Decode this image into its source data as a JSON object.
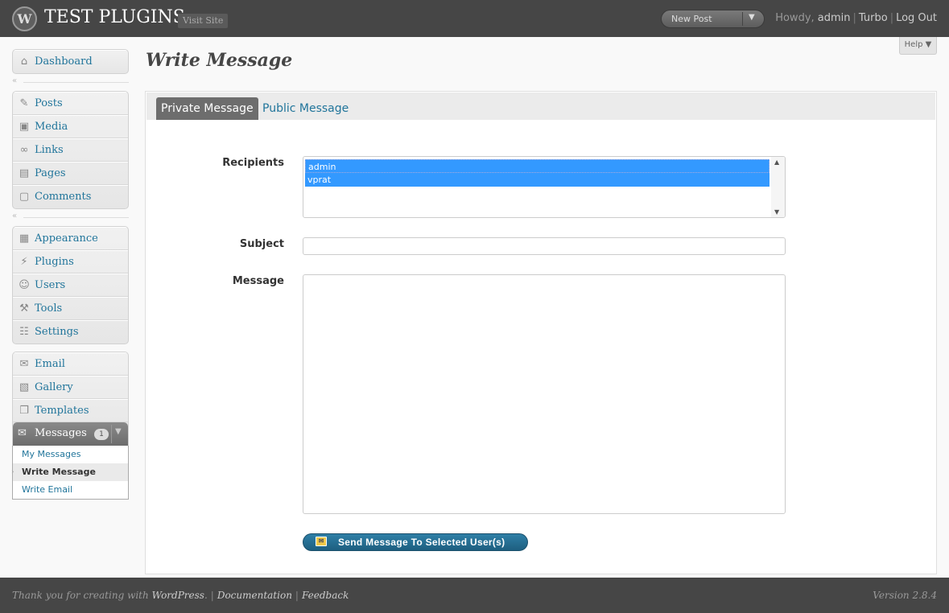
{
  "header": {
    "logo_glyph": "W",
    "site_title": "TEST PLUGINS",
    "visit_site": "Visit Site",
    "new_post": "New Post",
    "howdy_prefix": "Howdy,",
    "user": "admin",
    "turbo": "Turbo",
    "logout": "Log Out",
    "help": "Help"
  },
  "sidebar": {
    "group1": [
      {
        "label": "Dashboard",
        "icon": "home-icon"
      }
    ],
    "group2": [
      {
        "label": "Posts",
        "icon": "pin-icon"
      },
      {
        "label": "Media",
        "icon": "media-icon"
      },
      {
        "label": "Links",
        "icon": "link-icon"
      },
      {
        "label": "Pages",
        "icon": "pages-icon"
      },
      {
        "label": "Comments",
        "icon": "comment-icon"
      }
    ],
    "group3": [
      {
        "label": "Appearance",
        "icon": "appearance-icon"
      },
      {
        "label": "Plugins",
        "icon": "plugin-icon"
      },
      {
        "label": "Users",
        "icon": "users-icon"
      },
      {
        "label": "Tools",
        "icon": "tools-icon"
      },
      {
        "label": "Settings",
        "icon": "settings-icon"
      }
    ],
    "group4": [
      {
        "label": "Email",
        "icon": "email-icon"
      },
      {
        "label": "Gallery",
        "icon": "gallery-icon"
      },
      {
        "label": "Templates",
        "icon": "templates-icon"
      }
    ],
    "messages": {
      "label": "Messages",
      "badge": "1",
      "submenu": [
        "My Messages",
        "Write Message",
        "Write Email"
      ]
    }
  },
  "main": {
    "title": "Write Message",
    "tabs": [
      "Private Message",
      "Public Message"
    ],
    "form": {
      "recipients_label": "Recipients",
      "recipients": [
        "admin",
        "vprat"
      ],
      "subject_label": "Subject",
      "subject_value": "",
      "message_label": "Message",
      "message_value": "",
      "send_button": "Send Message To Selected User(s)"
    }
  },
  "footer": {
    "thanks": "Thank you for creating with",
    "wordpress": "WordPress",
    "period": ".",
    "documentation": "Documentation",
    "feedback": "Feedback",
    "version": "Version 2.8.4"
  }
}
